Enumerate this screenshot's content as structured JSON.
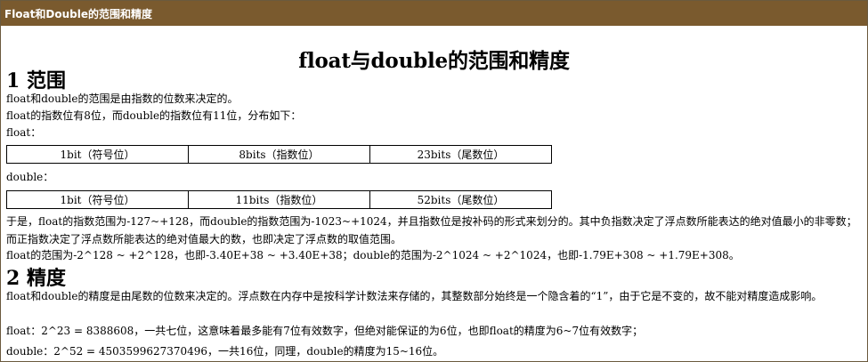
{
  "window": {
    "title": "Float和Double的范围和精度"
  },
  "article": {
    "title": "float与double的范围和精度",
    "section1": {
      "heading": "1 范围",
      "p1": "float和double的范围是由指数的位数来决定的。",
      "p2": "float的指数位有8位，而double的指数位有11位，分布如下：",
      "float_label": "float：",
      "float_table": [
        "1bit（符号位）",
        "8bits（指数位）",
        "23bits（尾数位）"
      ],
      "double_label": "double：",
      "double_table": [
        "1bit（符号位）",
        "11bits（指数位）",
        "52bits（尾数位）"
      ],
      "p3": "于是，float的指数范围为-127~+128，而double的指数范围为-1023~+1024，并且指数位是按补码的形式来划分的。其中负指数决定了浮点数所能表达的绝对值最小的非零数；而正指数决定了浮点数所能表达的绝对值最大的数，也即决定了浮点数的取值范围。",
      "p4": "float的范围为-2^128 ~ +2^128，也即-3.40E+38 ~ +3.40E+38；double的范围为-2^1024 ~ +2^1024，也即-1.79E+308 ~ +1.79E+308。"
    },
    "section2": {
      "heading": "2 精度",
      "p1": "float和double的精度是由尾数的位数来决定的。浮点数在内存中是按科学计数法来存储的，其整数部分始终是一个隐含着的“1”，由于它是不变的，故不能对精度造成影响。",
      "p2": "float：2^23 = 8388608，一共七位，这意味着最多能有7位有效数字，但绝对能保证的为6位，也即float的精度为6~7位有效数字；",
      "p3": "double：2^52 = 4503599627370496，一共16位，同理，double的精度为15~16位。"
    }
  }
}
